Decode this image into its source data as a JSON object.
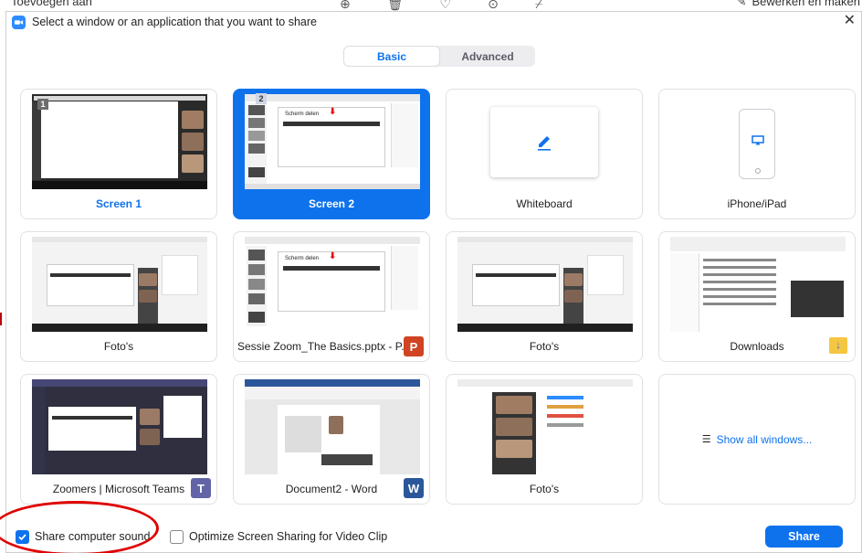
{
  "background": {
    "left_text": "Toevoegen aan",
    "right_text": "Bewerken en maken"
  },
  "dialog": {
    "title": "Select a window or an application that you want to share",
    "close_label": "✕"
  },
  "tabs": [
    {
      "label": "Basic",
      "active": true
    },
    {
      "label": "Advanced",
      "active": false
    }
  ],
  "cards": [
    {
      "label": "Screen 1",
      "number": "1",
      "selected": false
    },
    {
      "label": "Screen 2",
      "number": "2",
      "selected": true,
      "thumb_text": "Scherm delen"
    },
    {
      "label": "Whiteboard",
      "selected": false
    },
    {
      "label": "iPhone/iPad",
      "selected": false
    },
    {
      "label": "Foto's",
      "selected": false
    },
    {
      "label": "Sessie Zoom_The Basics.pptx - P...",
      "selected": false,
      "badge": "P",
      "thumb_text": "Scherm delen"
    },
    {
      "label": "Foto's",
      "selected": false
    },
    {
      "label": "Downloads",
      "selected": false
    },
    {
      "label": "Zoomers | Microsoft Teams",
      "selected": false,
      "badge": "T"
    },
    {
      "label": "Document2 - Word",
      "selected": false,
      "badge": "W"
    },
    {
      "label": "Foto's",
      "selected": false
    },
    {
      "label": "Show all windows...",
      "selected": false
    }
  ],
  "footer": {
    "share_sound_label": "Share computer sound",
    "share_sound_checked": true,
    "optimize_label": "Optimize Screen Sharing for Video Clip",
    "optimize_checked": false,
    "share_button": "Share"
  },
  "colors": {
    "accent": "#0e72ed",
    "annotation": "#e00000"
  }
}
